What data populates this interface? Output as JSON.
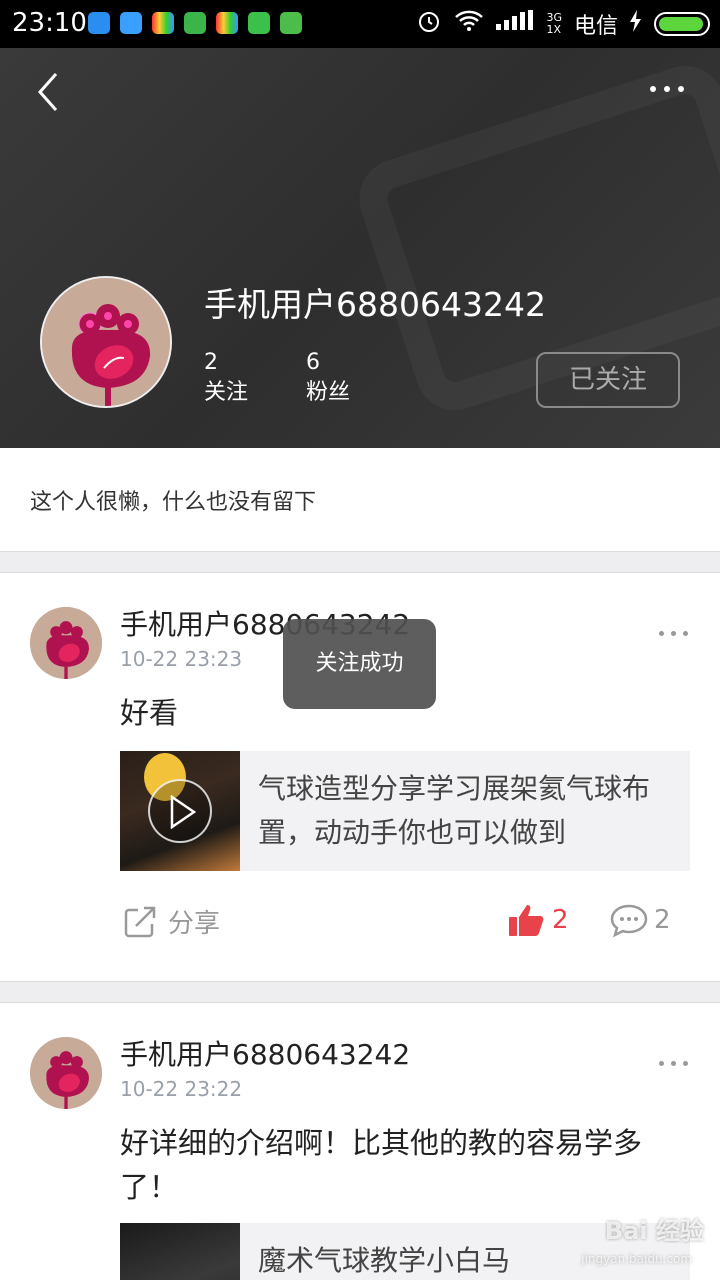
{
  "status_bar": {
    "time": "23:10",
    "network": "3G\n1X",
    "carrier": "电信"
  },
  "profile": {
    "username": "手机用户6880643242",
    "following_count": "2",
    "following_label": "关注",
    "followers_count": "6",
    "followers_label": "粉丝",
    "follow_button": "已关注",
    "bio": "这个人很懒，什么也没有留下"
  },
  "posts": [
    {
      "author": "手机用户6880643242",
      "time": "10-22 23:23",
      "text": "好看",
      "card_title": "气球造型分享学习展架氦气球布置，动动手你也可以做到",
      "share_label": "分享",
      "likes": "2",
      "comments": "2"
    },
    {
      "author": "手机用户6880643242",
      "time": "10-22 23:22",
      "text": "好详细的介绍啊！比其他的教的容易学多了！",
      "card_title": "魔术气球教学小白马"
    }
  ],
  "toast": "关注成功",
  "watermark": {
    "brand": "Bai 经验",
    "url": "jingyan.baidu.com"
  },
  "colors": {
    "header_bg": "#333333",
    "like_red": "#e8424a",
    "avatar_bg": "#c8aa98",
    "avatar_fg": "#b0124f"
  }
}
